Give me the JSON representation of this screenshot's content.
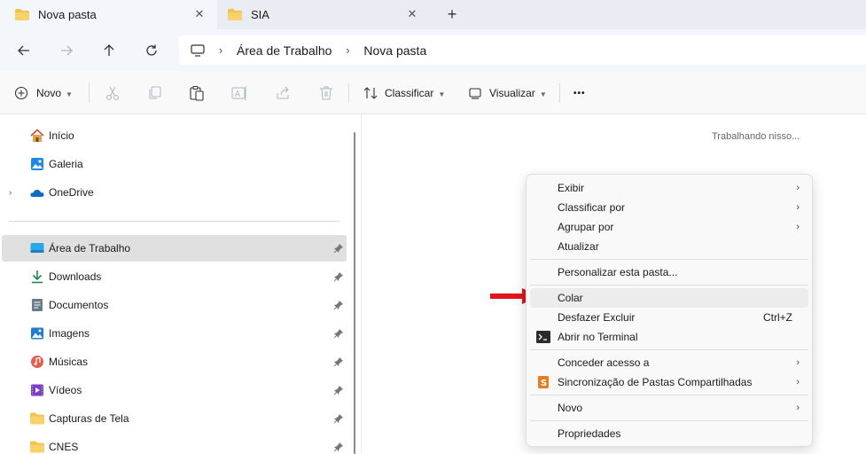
{
  "tabs": [
    {
      "label": "Nova pasta",
      "active": true
    },
    {
      "label": "SIA",
      "active": false
    }
  ],
  "breadcrumb": [
    "Área de Trabalho",
    "Nova pasta"
  ],
  "commandbar": {
    "new_label": "Novo",
    "sort_label": "Classificar",
    "view_label": "Visualizar",
    "more_label": "•••"
  },
  "sidebar": {
    "home": "Início",
    "gallery": "Galeria",
    "onedrive": "OneDrive",
    "pinned": [
      {
        "label": "Área de Trabalho",
        "icon": "desktop-icon"
      },
      {
        "label": "Downloads",
        "icon": "download-icon"
      },
      {
        "label": "Documentos",
        "icon": "documents-icon"
      },
      {
        "label": "Imagens",
        "icon": "pictures-icon"
      },
      {
        "label": "Músicas",
        "icon": "music-icon"
      },
      {
        "label": "Vídeos",
        "icon": "videos-icon"
      },
      {
        "label": "Capturas de Tela",
        "icon": "folder-icon"
      },
      {
        "label": "CNES",
        "icon": "folder-icon"
      }
    ]
  },
  "content": {
    "status": "Trabalhando nisso..."
  },
  "context_menu": {
    "view": "Exibir",
    "sort_by": "Classificar por",
    "group_by": "Agrupar por",
    "refresh": "Atualizar",
    "customize": "Personalizar esta pasta...",
    "paste": "Colar",
    "undo": "Desfazer Excluir",
    "undo_shortcut": "Ctrl+Z",
    "terminal": "Abrir no Terminal",
    "give_access": "Conceder acesso a",
    "sync": "Sincronização de Pastas Compartilhadas",
    "new": "Novo",
    "properties": "Propriedades"
  },
  "colors": {
    "folder": "#f2c14e",
    "accent": "#0067c0",
    "arrow": "#e0161b"
  }
}
